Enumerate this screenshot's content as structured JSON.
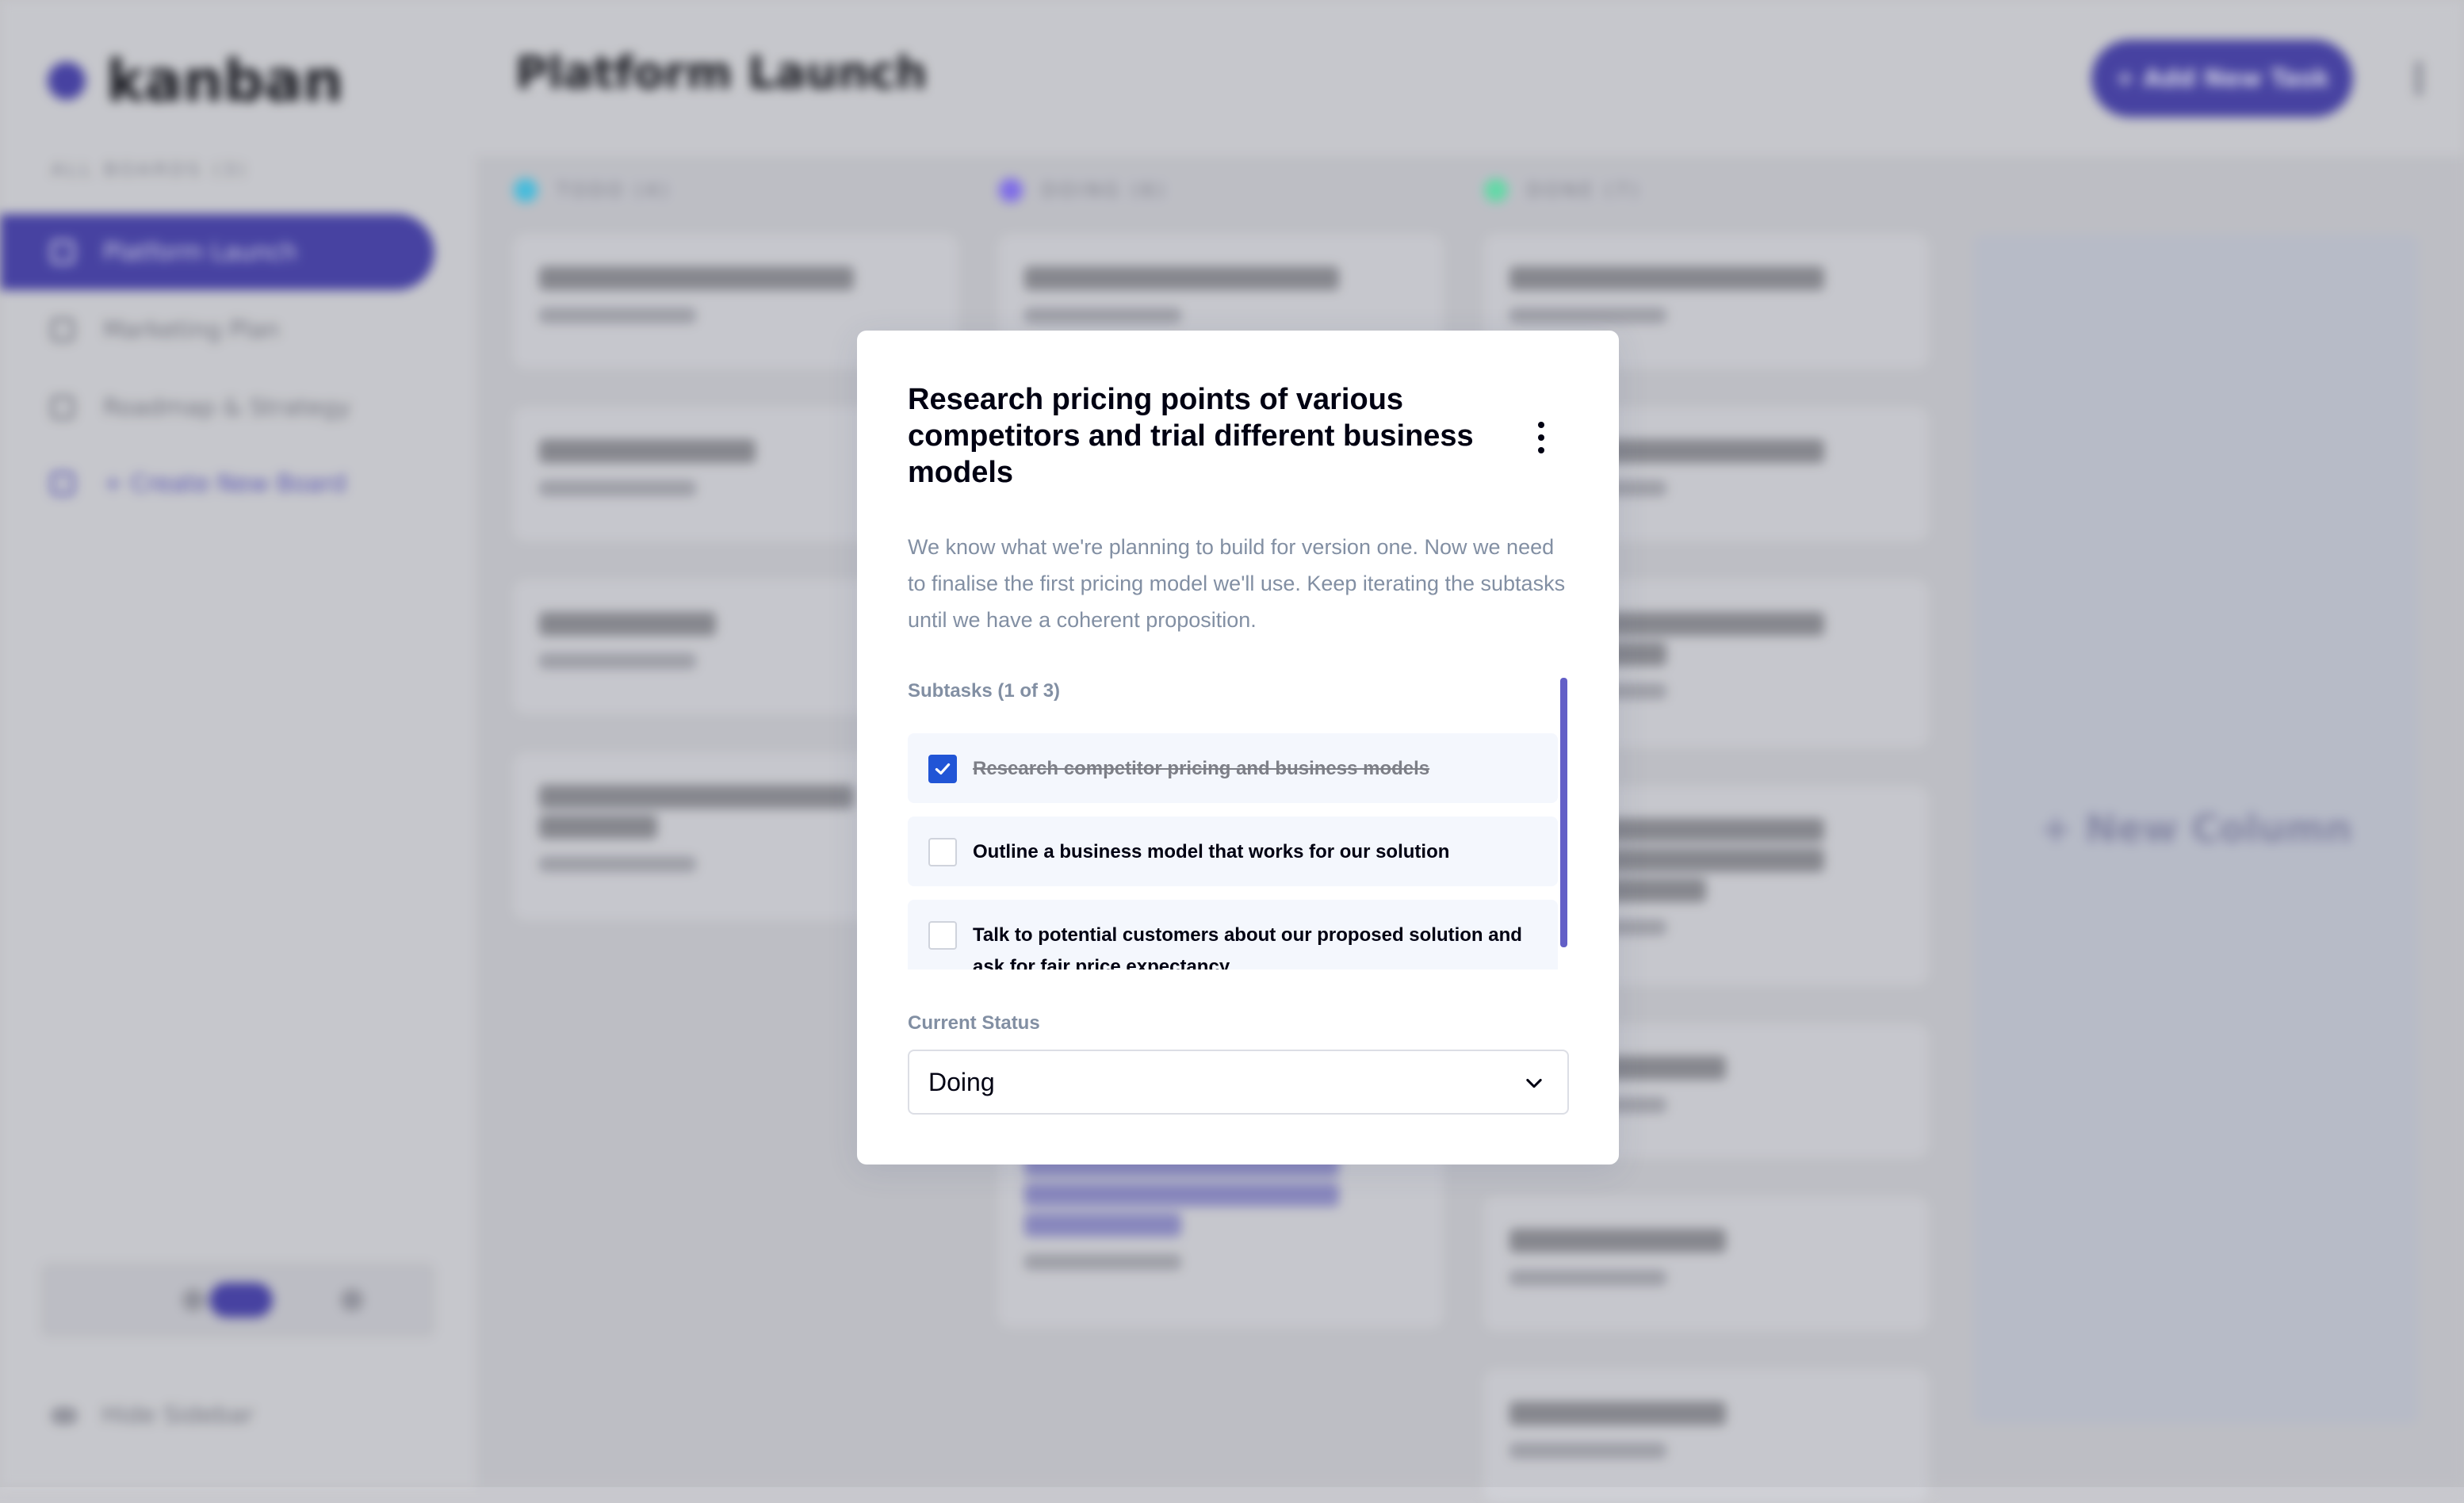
{
  "app": {
    "logo_text": "kanban",
    "boards_heading": "ALL BOARDS (3)",
    "boards": [
      "Platform Launch",
      "Marketing Plan",
      "Roadmap & Strategy"
    ],
    "create_board": "+ Create New Board",
    "hide_sidebar": "Hide Sidebar",
    "board_title": "Platform Launch",
    "add_task": "+ Add New Task",
    "columns": [
      "TODO (4)",
      "DOING (6)",
      "DONE (7)"
    ],
    "new_column": "+ New Column",
    "colors": {
      "accent": "#635fc7",
      "todo": "#49c4e5",
      "doing": "#8471f2",
      "done": "#67e2ae"
    }
  },
  "modal": {
    "title": "Research pricing points of various competitors and trial different business models",
    "description": "We know what we're planning to build for version one. Now we need to finalise the first pricing model we'll use. Keep iterating the subtasks until we have a coherent proposition.",
    "subtasks_label": "Subtasks (1 of 3)",
    "subtasks": [
      {
        "text": "Research competitor pricing and business models",
        "done": true
      },
      {
        "text": "Outline a business model that works for our solution",
        "done": false
      },
      {
        "text": "Talk to potential customers about our proposed solution and ask for fair price expectancy",
        "done": false
      }
    ],
    "status_label": "Current Status",
    "status_value": "Doing",
    "icons": {
      "menu": "vertical-ellipsis-icon",
      "check": "check-icon",
      "dropdown": "chevron-down-icon"
    }
  }
}
